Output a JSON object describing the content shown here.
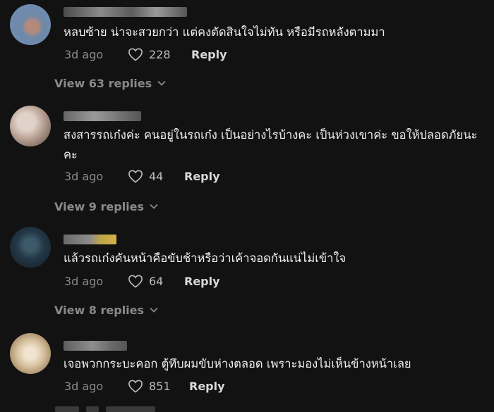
{
  "comments": [
    {
      "text": "หลบซ้าย น่าจะสวยกว่า แต่คงตัดสินใจไม่ทัน หรือมีรถหลังตามมา",
      "time": "3d ago",
      "likes": "228",
      "reply_label": "Reply",
      "view_replies": "View 63 replies"
    },
    {
      "text": "สงสารรถเก๋งค่ะ คนอยู่ในรถเก๋ง เป็นอย่างไรบ้างคะ เป็นห่วงเขาค่ะ ขอให้ปลอดภัยนะคะ",
      "time": "3d ago",
      "likes": "44",
      "reply_label": "Reply",
      "view_replies": "View 9 replies"
    },
    {
      "text": "แล้วรถเก๋งคันหน้าคือขับช้าหรือว่าเค้าจอดกันแน่ไม่เข้าใจ",
      "time": "3d ago",
      "likes": "64",
      "reply_label": "Reply",
      "view_replies": "View 8 replies"
    },
    {
      "text": "เจอพวกกระบะคอก ตู้ทึบผมขับห่างตลอด เพราะมองไม่เห็นข้างหน้าเลย",
      "time": "3d ago",
      "likes": "851",
      "reply_label": "Reply"
    }
  ],
  "icons": {
    "like": "heart-outline-icon",
    "expand": "chevron-down-icon"
  },
  "colors": {
    "background": "#121212",
    "muted": "#8a8a8a",
    "text": "#f1f1f1"
  }
}
